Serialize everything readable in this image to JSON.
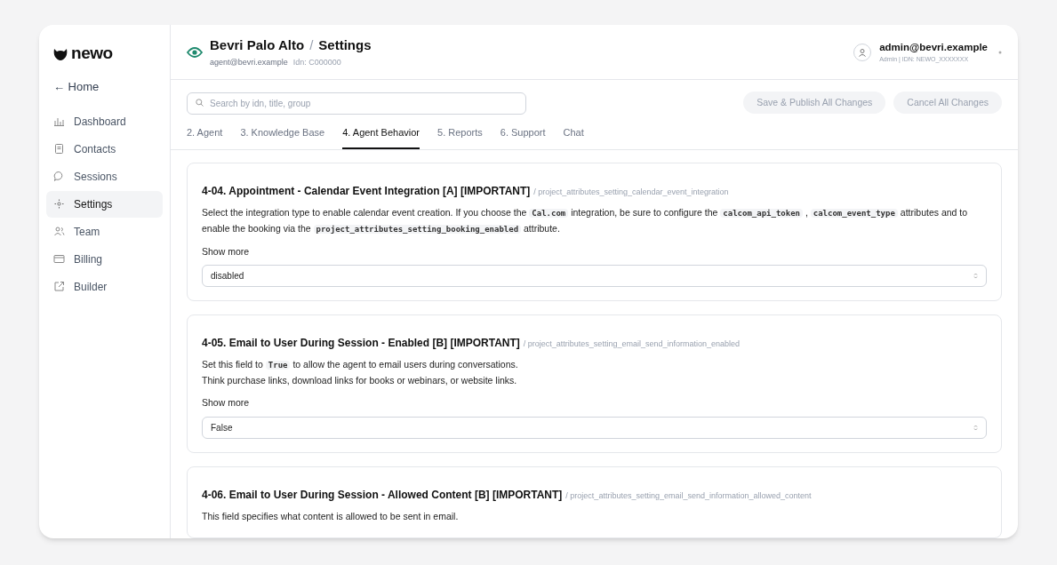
{
  "logo": {
    "text": "newo"
  },
  "sidebar": {
    "back": "← Home",
    "items": [
      {
        "label": "Dashboard",
        "selected": false
      },
      {
        "label": "Contacts",
        "selected": false
      },
      {
        "label": "Sessions",
        "selected": false
      },
      {
        "label": "Settings",
        "selected": true
      },
      {
        "label": "Team",
        "selected": false
      },
      {
        "label": "Billing",
        "selected": false
      },
      {
        "label": "Builder",
        "selected": false
      }
    ]
  },
  "header": {
    "title": "Bevri Palo Alto",
    "separator": "/",
    "page": "Settings",
    "email": "agent@bevri.example",
    "idn": "Idn: C000000",
    "user": {
      "name": "admin@bevri.example",
      "role": "Admin | IDN: NEWO_XXXXXXX"
    }
  },
  "search": {
    "placeholder": "Search by idn, title, group"
  },
  "buttons": [
    {
      "label": "Save & Publish All Changes",
      "disabled": true
    },
    {
      "label": "Cancel All Changes",
      "disabled": true
    }
  ],
  "tabs": [
    {
      "label": "2. Agent",
      "selected": false
    },
    {
      "label": "3. Knowledge Base",
      "selected": false
    },
    {
      "label": "4. Agent Behavior",
      "selected": true
    },
    {
      "label": "5. Reports",
      "selected": false
    },
    {
      "label": "6. Support",
      "selected": false
    },
    {
      "label": "Chat",
      "selected": false
    }
  ],
  "settings": [
    {
      "title": "4-04. Appointment - Calendar Event Integration [A] [IMPORTANT]",
      "idn": "/ project_attributes_setting_calendar_event_integration",
      "description": [
        [
          {
            "kind": "text",
            "text": "Select the integration type to enable calendar event creation. If you choose the "
          },
          {
            "kind": "code",
            "text": "Cal.com"
          },
          {
            "kind": "text",
            "text": " integration, be sure to configure the "
          },
          {
            "kind": "code",
            "text": "calcom_api_token"
          },
          {
            "kind": "text",
            "text": " , "
          },
          {
            "kind": "code",
            "text": "calcom_event_type"
          },
          {
            "kind": "text",
            "text": " attributes and to enable the booking via the "
          },
          {
            "kind": "code",
            "text": "project_attributes_setting_booking_enabled"
          },
          {
            "kind": "text",
            "text": " attribute."
          }
        ]
      ],
      "show_more": "Show more",
      "value": "disabled"
    },
    {
      "title": "4-05. Email to User During Session - Enabled [B] [IMPORTANT]",
      "idn": "/ project_attributes_setting_email_send_information_enabled",
      "description": [
        [
          {
            "kind": "text",
            "text": "Set this field to "
          },
          {
            "kind": "code",
            "text": "True"
          },
          {
            "kind": "text",
            "text": " to allow the agent to email users during conversations."
          }
        ],
        [
          {
            "kind": "text",
            "text": "Think purchase links, download links for books or webinars, or website links."
          }
        ]
      ],
      "show_more": "Show more",
      "value": "False"
    },
    {
      "title": "4-06. Email to User During Session - Allowed Content [B] [IMPORTANT]",
      "idn": "/ project_attributes_setting_email_send_information_allowed_content",
      "description": [
        [
          {
            "kind": "text",
            "text": "This field specifies what content is allowed to be sent in email."
          }
        ]
      ]
    }
  ]
}
